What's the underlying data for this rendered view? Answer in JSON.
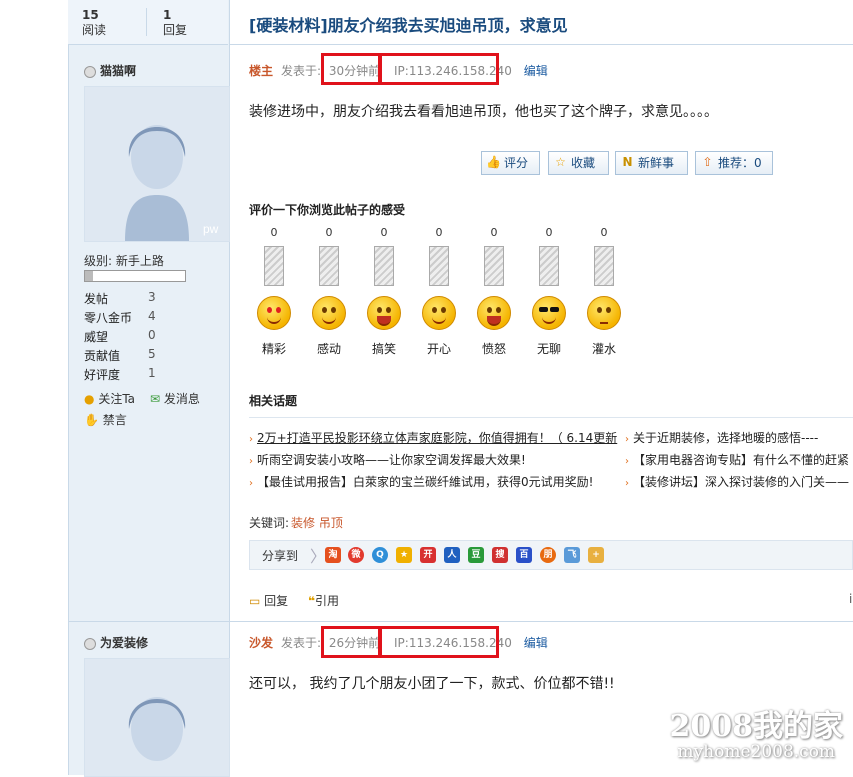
{
  "stats": {
    "views_num": "15",
    "views_label": "阅读",
    "replies_num": "1",
    "replies_label": "回复"
  },
  "thread_title": "[硬装材料]朋友介绍我去买旭迪吊顶，求意见",
  "post1": {
    "username": "猫猫啊",
    "level_label": "级别: 新手上路",
    "user_stats": [
      {
        "label": "发帖",
        "value": "3"
      },
      {
        "label": "零八金币",
        "value": "4"
      },
      {
        "label": "威望",
        "value": "0"
      },
      {
        "label": "贡献值",
        "value": "5"
      },
      {
        "label": "好评度",
        "value": "1"
      }
    ],
    "follow_label": "关注Ta",
    "message_label": "发消息",
    "ban_label": "禁言",
    "role": "楼主",
    "posted_prefix": "发表于:",
    "time": "30分钟前",
    "ip": "IP:113.246.158.240",
    "edit": "编辑",
    "content": "装修进场中，朋友介绍我去看看旭迪吊顶，他也买了这个牌子，求意见。。。。",
    "buttons": {
      "rate": "评分",
      "favorite": "收藏",
      "fresh": "新鲜事",
      "recommend": "推荐：0"
    }
  },
  "mood_section": {
    "title": "评价一下你浏览此帖子的感受",
    "moods": [
      {
        "label": "精彩",
        "count": "0"
      },
      {
        "label": "感动",
        "count": "0"
      },
      {
        "label": "搞笑",
        "count": "0"
      },
      {
        "label": "开心",
        "count": "0"
      },
      {
        "label": "愤怒",
        "count": "0"
      },
      {
        "label": "无聊",
        "count": "0"
      },
      {
        "label": "灌水",
        "count": "0"
      }
    ]
  },
  "related": {
    "title": "相关话题",
    "left": [
      "2万+打造平民投影环绕立体声家庭影院，你值得拥有！（ 6.14更新",
      "听雨空调安装小攻略——让你家空调发挥最大效果!",
      "【最佳试用报告】白萊家的宝兰碳纤維试用，获得0元试用奖励!"
    ],
    "right": [
      "关于近期装修，选择地暖的感悟----",
      "【家用电器咨询专贴】有什么不懂的赶紧",
      "【装修讲坛】深入探讨装修的入门关——"
    ]
  },
  "keywords": {
    "label": "关键词:",
    "k1": "装修",
    "k2": "吊顶"
  },
  "share": {
    "label": "分享到"
  },
  "actions": {
    "reply": "回复",
    "quote": "引用"
  },
  "post2": {
    "username": "为爱装修",
    "role": "沙发",
    "posted_prefix": "发表于:",
    "time": "26分钟前",
    "ip": "IP:113.246.158.240",
    "edit": "编辑",
    "content": "还可以， 我约了几个朋友小团了一下，款式、价位都不错!!"
  },
  "watermark": {
    "line1": "2008我的家",
    "line2": "myhome2008.com"
  }
}
